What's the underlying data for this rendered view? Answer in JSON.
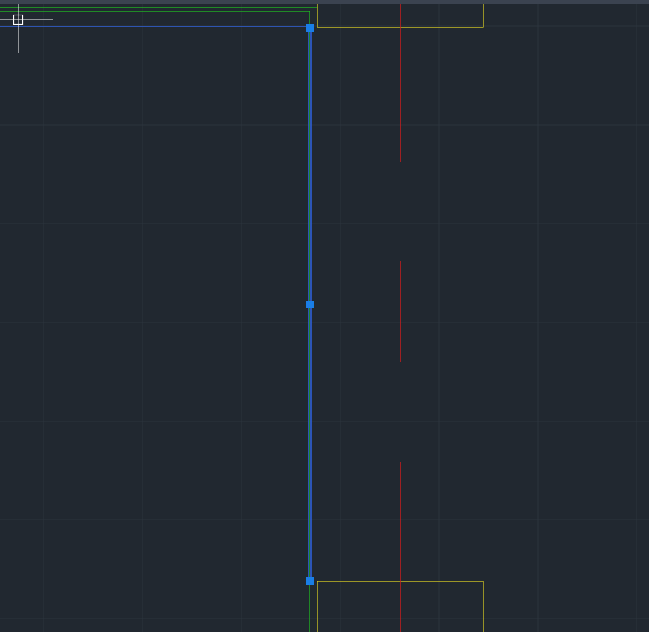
{
  "colors": {
    "canvas_background": "#212830",
    "top_strip": "#3b4350",
    "grid_line": "#2c343d",
    "green_polyline": "#20c420",
    "blue_selected_line": "#2f5fd8",
    "grip_fill": "#1a7ee6",
    "yellow_rectangle": "#e6d822",
    "red_centerline": "#c81e1e",
    "crosshair_cursor": "#ffffff"
  },
  "icons": {
    "cursor": "crosshair-pickbox-cursor",
    "grip": "square-grip-handle"
  }
}
